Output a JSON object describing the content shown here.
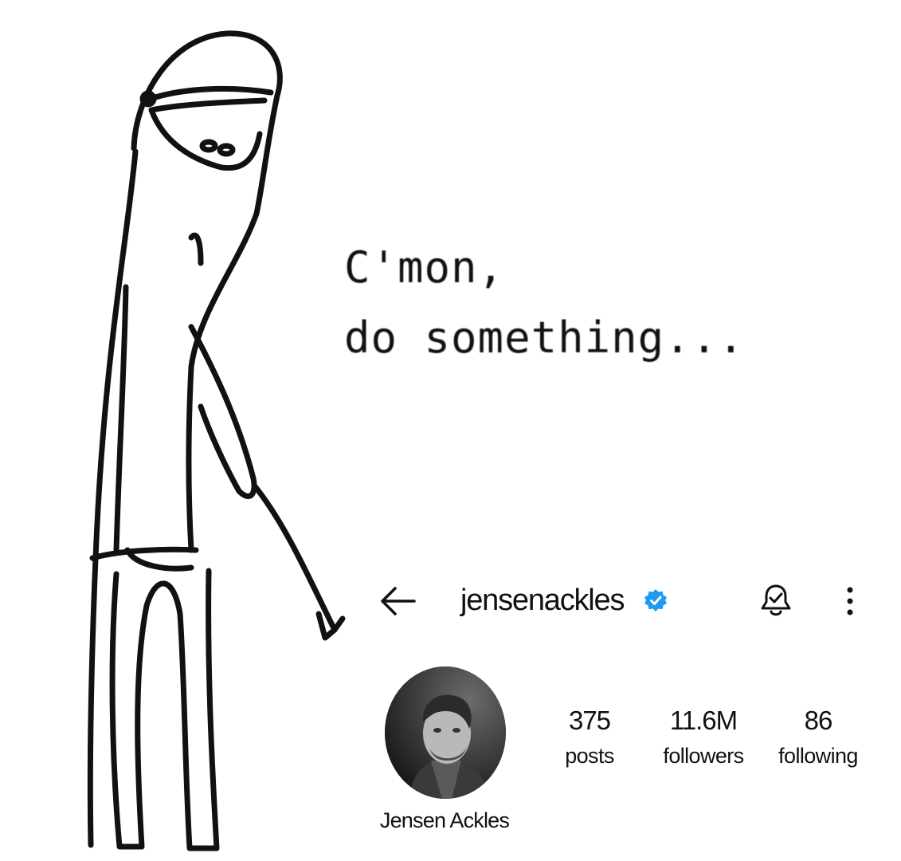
{
  "meme": {
    "caption_line1": "C'mon,",
    "caption_line2": "do something..."
  },
  "profile": {
    "username": "jensenackles",
    "verified": true,
    "display_name": "Jensen Ackles",
    "stats": {
      "posts_count": "375",
      "posts_label": "posts",
      "followers_count": "11.6M",
      "followers_label": "followers",
      "following_count": "86",
      "following_label": "following"
    },
    "icons": {
      "back": "back-arrow-icon",
      "verified": "verified-badge-icon",
      "notifications": "bell-check-icon",
      "more": "more-vertical-icon"
    },
    "colors": {
      "verified": "#1d9bf0",
      "text": "#111111"
    }
  }
}
